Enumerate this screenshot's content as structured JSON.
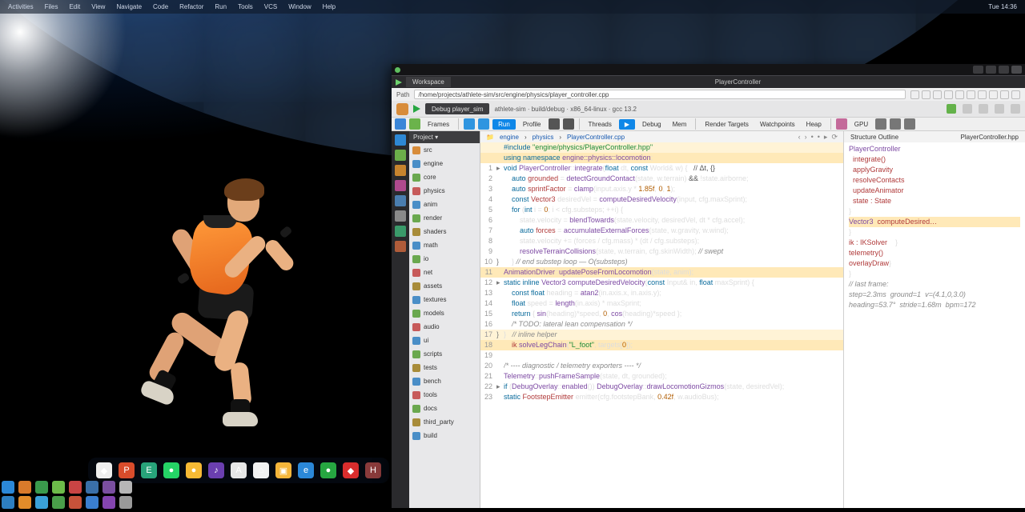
{
  "menubar": [
    "Activities",
    "Files",
    "Edit",
    "View",
    "Navigate",
    "Code",
    "Refactor",
    "Run",
    "Tools",
    "VCS",
    "Window",
    "Help",
    "Tue 14:36"
  ],
  "dock": [
    {
      "bg": "#efefef",
      "g": "◆"
    },
    {
      "bg": "#d84c2b",
      "g": "P"
    },
    {
      "bg": "#28a37a",
      "g": "E"
    },
    {
      "bg": "#25d366",
      "g": "●"
    },
    {
      "bg": "#f7b934",
      "g": "●"
    },
    {
      "bg": "#6b3fb0",
      "g": "♪"
    },
    {
      "bg": "#e7e7e7",
      "g": "A"
    },
    {
      "bg": "#f2f2f2",
      "g": "⌂"
    },
    {
      "bg": "#f5b53a",
      "g": "▣"
    },
    {
      "bg": "#2b88d8",
      "g": "e"
    },
    {
      "bg": "#26a641",
      "g": "●"
    },
    {
      "bg": "#d92d2d",
      "g": "◆"
    },
    {
      "bg": "#8a3b3b",
      "g": "H"
    }
  ],
  "tb1": [
    {
      "bg": "#2b88d8"
    },
    {
      "bg": "#d87a2b"
    },
    {
      "bg": "#3a9a4c"
    },
    {
      "bg": "#6dbb49"
    },
    {
      "bg": "#c94444"
    },
    {
      "bg": "#3a6fa8"
    },
    {
      "bg": "#7a4fa0"
    },
    {
      "bg": "#b6b6b6"
    }
  ],
  "tb2": [
    {
      "bg": "#2d7fc1"
    },
    {
      "bg": "#e28c2a"
    },
    {
      "bg": "#3aa0d8"
    },
    {
      "bg": "#4a9e4a"
    },
    {
      "bg": "#c7523a"
    },
    {
      "bg": "#3a7ecf"
    },
    {
      "bg": "#8445b0"
    },
    {
      "bg": "#9a9a9a"
    }
  ],
  "ide": {
    "title_tab": "Workspace",
    "center_tab": "PlayerController",
    "url_label": "Path",
    "url": "/home/projects/athlete-sim/src/engine/physics/player_controller.cpp",
    "run_config": "Debug  player_sim",
    "run_target": "athlete-sim · build/debug · x86_64-linux · gcc 13.2",
    "run_icons": [
      "#64b24a",
      "#c8c8c8",
      "#c8c8c8",
      "#c8c8c8",
      "#c8c8c8"
    ],
    "toolbar": [
      {
        "t": "sq",
        "bg": "#3a86d8"
      },
      {
        "t": "sq",
        "bg": "#6bb34b"
      },
      {
        "t": "lbl",
        "v": "Frames"
      },
      {
        "t": "sep"
      },
      {
        "t": "sq",
        "bg": "#2f95e0"
      },
      {
        "t": "sq",
        "bg": "#2f95e0"
      },
      {
        "t": "blue",
        "v": "Run"
      },
      {
        "t": "lbl",
        "v": "Profile"
      },
      {
        "t": "sq",
        "bg": "#555"
      },
      {
        "t": "sq",
        "bg": "#555"
      },
      {
        "t": "sep"
      },
      {
        "t": "lbl",
        "v": "Threads"
      },
      {
        "t": "blue",
        "v": "▶"
      },
      {
        "t": "lbl",
        "v": "Debug"
      },
      {
        "t": "lbl",
        "v": "Mem"
      },
      {
        "t": "sep"
      },
      {
        "t": "lbl",
        "v": "Render Targets"
      },
      {
        "t": "lbl",
        "v": "Watchpoints"
      },
      {
        "t": "lbl",
        "v": "Heap"
      },
      {
        "t": "sep"
      },
      {
        "t": "sq",
        "bg": "#c46a9a"
      },
      {
        "t": "lbl",
        "v": "GPU"
      },
      {
        "t": "sq",
        "bg": "#777"
      },
      {
        "t": "sq",
        "bg": "#777"
      },
      {
        "t": "sq",
        "bg": "#777"
      }
    ],
    "rail": [
      "#2e88d4",
      "#6cae4a",
      "#c7842e",
      "#b04a8e",
      "#4a7eb0",
      "#8a8a8a",
      "#3a9a6a",
      "#b05c3a"
    ],
    "tree_header": "Project  ▾",
    "tree": [
      {
        "c": "#d88c3a",
        "l": "src"
      },
      {
        "c": "#4a8ec7",
        "l": "engine"
      },
      {
        "c": "#6aa84f",
        "l": "core"
      },
      {
        "c": "#c75a5a",
        "l": "physics"
      },
      {
        "c": "#4a8ec7",
        "l": "anim"
      },
      {
        "c": "#6aa84f",
        "l": "render"
      },
      {
        "c": "#a88c3a",
        "l": "shaders"
      },
      {
        "c": "#4a8ec7",
        "l": "math"
      },
      {
        "c": "#6aa84f",
        "l": "io"
      },
      {
        "c": "#c75a5a",
        "l": "net"
      },
      {
        "c": "#a88c3a",
        "l": "assets"
      },
      {
        "c": "#4a8ec7",
        "l": "textures"
      },
      {
        "c": "#6aa84f",
        "l": "models"
      },
      {
        "c": "#c75a5a",
        "l": "audio"
      },
      {
        "c": "#4a8ec7",
        "l": "ui"
      },
      {
        "c": "#6aa84f",
        "l": "scripts"
      },
      {
        "c": "#a88c3a",
        "l": "tests"
      },
      {
        "c": "#4a8ec7",
        "l": "bench"
      },
      {
        "c": "#c75a5a",
        "l": "tools"
      },
      {
        "c": "#6aa84f",
        "l": "docs"
      },
      {
        "c": "#a88c3a",
        "l": "third_party"
      },
      {
        "c": "#4a8ec7",
        "l": "build"
      }
    ],
    "breadcrumb": [
      "engine",
      "physics",
      "PlayerController.cpp"
    ],
    "bc_ctrl": [
      "‹",
      "›",
      "•",
      "•",
      "▸",
      "⟳"
    ],
    "bc_right": "PlayerController.hpp",
    "code": [
      {
        "n": "",
        "g": "",
        "hl": 2,
        "h": "<span class='kw'>#include</span> <span class='str'>\"engine/physics/PlayerController.hpp\"</span>"
      },
      {
        "n": "",
        "g": "",
        "hl": 1,
        "h": "<span class='kw'>using namespace</span> <span class='fn'>engine::physics::locomotion</span>;"
      },
      {
        "n": "1",
        "g": "▸",
        "hl": 0,
        "h": "<span class='kw'>void</span> <span class='fn'>PlayerController</span>::<span class='fn'>integrate</span>(<span class='kw'>float</span> dt, <span class='kw'>const</span> World&amp; w) {   <span class='op'>// Δt, {}</span>"
      },
      {
        "n": "2",
        "g": "",
        "hl": 0,
        "h": "    <span class='kw'>auto</span> <span class='id'>grounded</span> = <span class='fn'>detectGroundContact</span>(state, w.terrain) <span class='op'>&amp;&amp;</span> !state.airborne;"
      },
      {
        "n": "3",
        "g": "",
        "hl": 0,
        "h": "    <span class='kw'>auto</span> <span class='id'>sprintFactor</span> = <span class='fn'>clamp</span>(input.axis.y * <span class='num'>1.85f</span>, <span class='num'>0</span>, <span class='num'>1</span>);"
      },
      {
        "n": "4",
        "g": "",
        "hl": 0,
        "h": "    <span class='kw'>const</span> <span class='id'>Vector3</span> desiredVel = <span class='fn'>computeDesiredVelocity</span>(input, cfg.maxSprint);"
      },
      {
        "n": "5",
        "g": "",
        "hl": 0,
        "h": "    <span class='kw'>for</span> (<span class='kw'>int</span> i = <span class='num'>0</span>; i &lt; cfg.substeps; ++i) {"
      },
      {
        "n": "6",
        "g": "",
        "hl": 0,
        "h": "        state.velocity = <span class='fn'>blendTowards</span>(state.velocity, desiredVel, dt * cfg.accel);"
      },
      {
        "n": "7",
        "g": "",
        "hl": 0,
        "h": "        <span class='kw'>auto</span> <span class='id'>forces</span> = <span class='fn'>accumulateExternalForces</span>(state, w.gravity, w.wind);"
      },
      {
        "n": "8",
        "g": "",
        "hl": 0,
        "h": "        state.velocity += (forces / cfg.mass) * (dt / cfg.substeps);"
      },
      {
        "n": "9",
        "g": "",
        "hl": 0,
        "h": "        <span class='fn'>resolveTerrainCollisions</span>(state, w.terrain, cfg.skinWidth); <span class='com'>// swept</span>"
      },
      {
        "n": "10",
        "g": "}",
        "hl": 0,
        "h": "    } <span class='com'>// end substep loop — O(substeps)</span>"
      },
      {
        "n": "11",
        "g": "",
        "hl": 1,
        "h": "<span class='fn'>AnimationDriver</span>::<span class='fn'>updatePoseFromLocomotion</span>(state, anim);"
      },
      {
        "n": "12",
        "g": "▸",
        "hl": 0,
        "h": "<span class='kw'>static</span> <span class='kw'>inline</span> <span class='fn'>Vector3</span> <span class='fn'>computeDesiredVelocity</span>(<span class='kw'>const</span> Input&amp; in, <span class='kw'>float</span> maxSprint) {"
      },
      {
        "n": "13",
        "g": "",
        "hl": 0,
        "h": "    <span class='kw'>const</span> <span class='kw'>float</span> heading = <span class='fn'>atan2</span>(in.axis.x, in.axis.y);"
      },
      {
        "n": "14",
        "g": "",
        "hl": 0,
        "h": "    <span class='kw'>float</span> speed = <span class='fn'>length</span>(in.axis) * maxSprint;"
      },
      {
        "n": "15",
        "g": "",
        "hl": 0,
        "h": "    <span class='kw'>return</span> { <span class='fn'>sin</span>(heading)*speed, <span class='num'>0</span>, <span class='fn'>cos</span>(heading)*speed };"
      },
      {
        "n": "16",
        "g": "",
        "hl": 0,
        "h": "    <span class='com'>/* TODO: lateral lean compensation */</span>"
      },
      {
        "n": "17",
        "g": "}",
        "hl": 2,
        "h": "}   <span class='com'>// inline helper</span>"
      },
      {
        "n": "18",
        "g": "",
        "hl": 1,
        "h": "    <span class='id'>ik</span>.<span class='fn'>solveLegChain</span>(<span class='str'>\"L_foot\"</span>, targets[<span class='num'>0</span>]);"
      },
      {
        "n": "19",
        "g": "",
        "hl": 0,
        "h": ""
      },
      {
        "n": "20",
        "g": "",
        "hl": 0,
        "h": "<span class='com'>/* ---- diagnostic / telemetry exporters ---- */</span>"
      },
      {
        "n": "21",
        "g": "",
        "hl": 0,
        "h": "<span class='fn'>Telemetry</span>::<span class='fn'>pushFrameSample</span>(state, dt, grounded);"
      },
      {
        "n": "22",
        "g": "▸",
        "hl": 0,
        "h": "<span class='kw'>if</span> (<span class='fn'>DebugOverlay</span>::<span class='fn'>enabled</span>()) <span class='fn'>DebugOverlay</span>::<span class='fn'>drawLocomotionGizmos</span>(state, desiredVel);"
      },
      {
        "n": "23",
        "g": "",
        "hl": 0,
        "h": "<span class='kw'>static</span> <span class='id'>FootstepEmitter</span> emitter(cfg.footstepBank, <span class='num'>0.42f</span>, w.audioBus);"
      }
    ],
    "side_header": "Structure   Outline",
    "side": [
      {
        "hl": 0,
        "h": "<span class='fn'>PlayerController</span>"
      },
      {
        "hl": 0,
        "h": "  <span class='id'>integrate()</span>"
      },
      {
        "hl": 0,
        "h": "  <span class='id'>applyGravity</span>"
      },
      {
        "hl": 0,
        "h": "  <span class='id'>resolveContacts</span>"
      },
      {
        "hl": 0,
        "h": "  <span class='id'>updateAnimator</span>"
      },
      {
        "hl": 0,
        "h": "  <span class='id'>state : State</span>"
      },
      {
        "hl": 0,
        "h": "}"
      },
      {
        "hl": 0,
        "h": ""
      },
      {
        "hl": 0,
        "h": ""
      },
      {
        "hl": 0,
        "h": ""
      },
      {
        "hl": 1,
        "h": "<span class='fn'>Vector3</span>  <span class='id'>computeDesired…</span>"
      },
      {
        "hl": 0,
        "h": "}"
      },
      {
        "hl": 0,
        "h": ""
      },
      {
        "hl": 0,
        "h": "<span class='id'>ik : IKSolver</span>    }"
      },
      {
        "hl": 0,
        "h": "<span class='id'>telemetry()</span>"
      },
      {
        "hl": 0,
        "h": "<span class='id'>overlayDraw</span>}"
      },
      {
        "hl": 0,
        "h": ""
      },
      {
        "hl": 2,
        "h": "}"
      },
      {
        "hl": 1,
        "h": ""
      },
      {
        "hl": 0,
        "h": ""
      },
      {
        "hl": 0,
        "h": "<span class='com'>// last frame:</span>"
      },
      {
        "hl": 0,
        "h": ""
      },
      {
        "hl": 2,
        "h": "<span class='com'>step=2.3ms  ground=1  v=(4.1,0,3.0)</span>"
      },
      {
        "hl": 2,
        "h": "<span class='com'>heading=53.7°  stride=1.68m  bpm=172</span>"
      }
    ]
  }
}
